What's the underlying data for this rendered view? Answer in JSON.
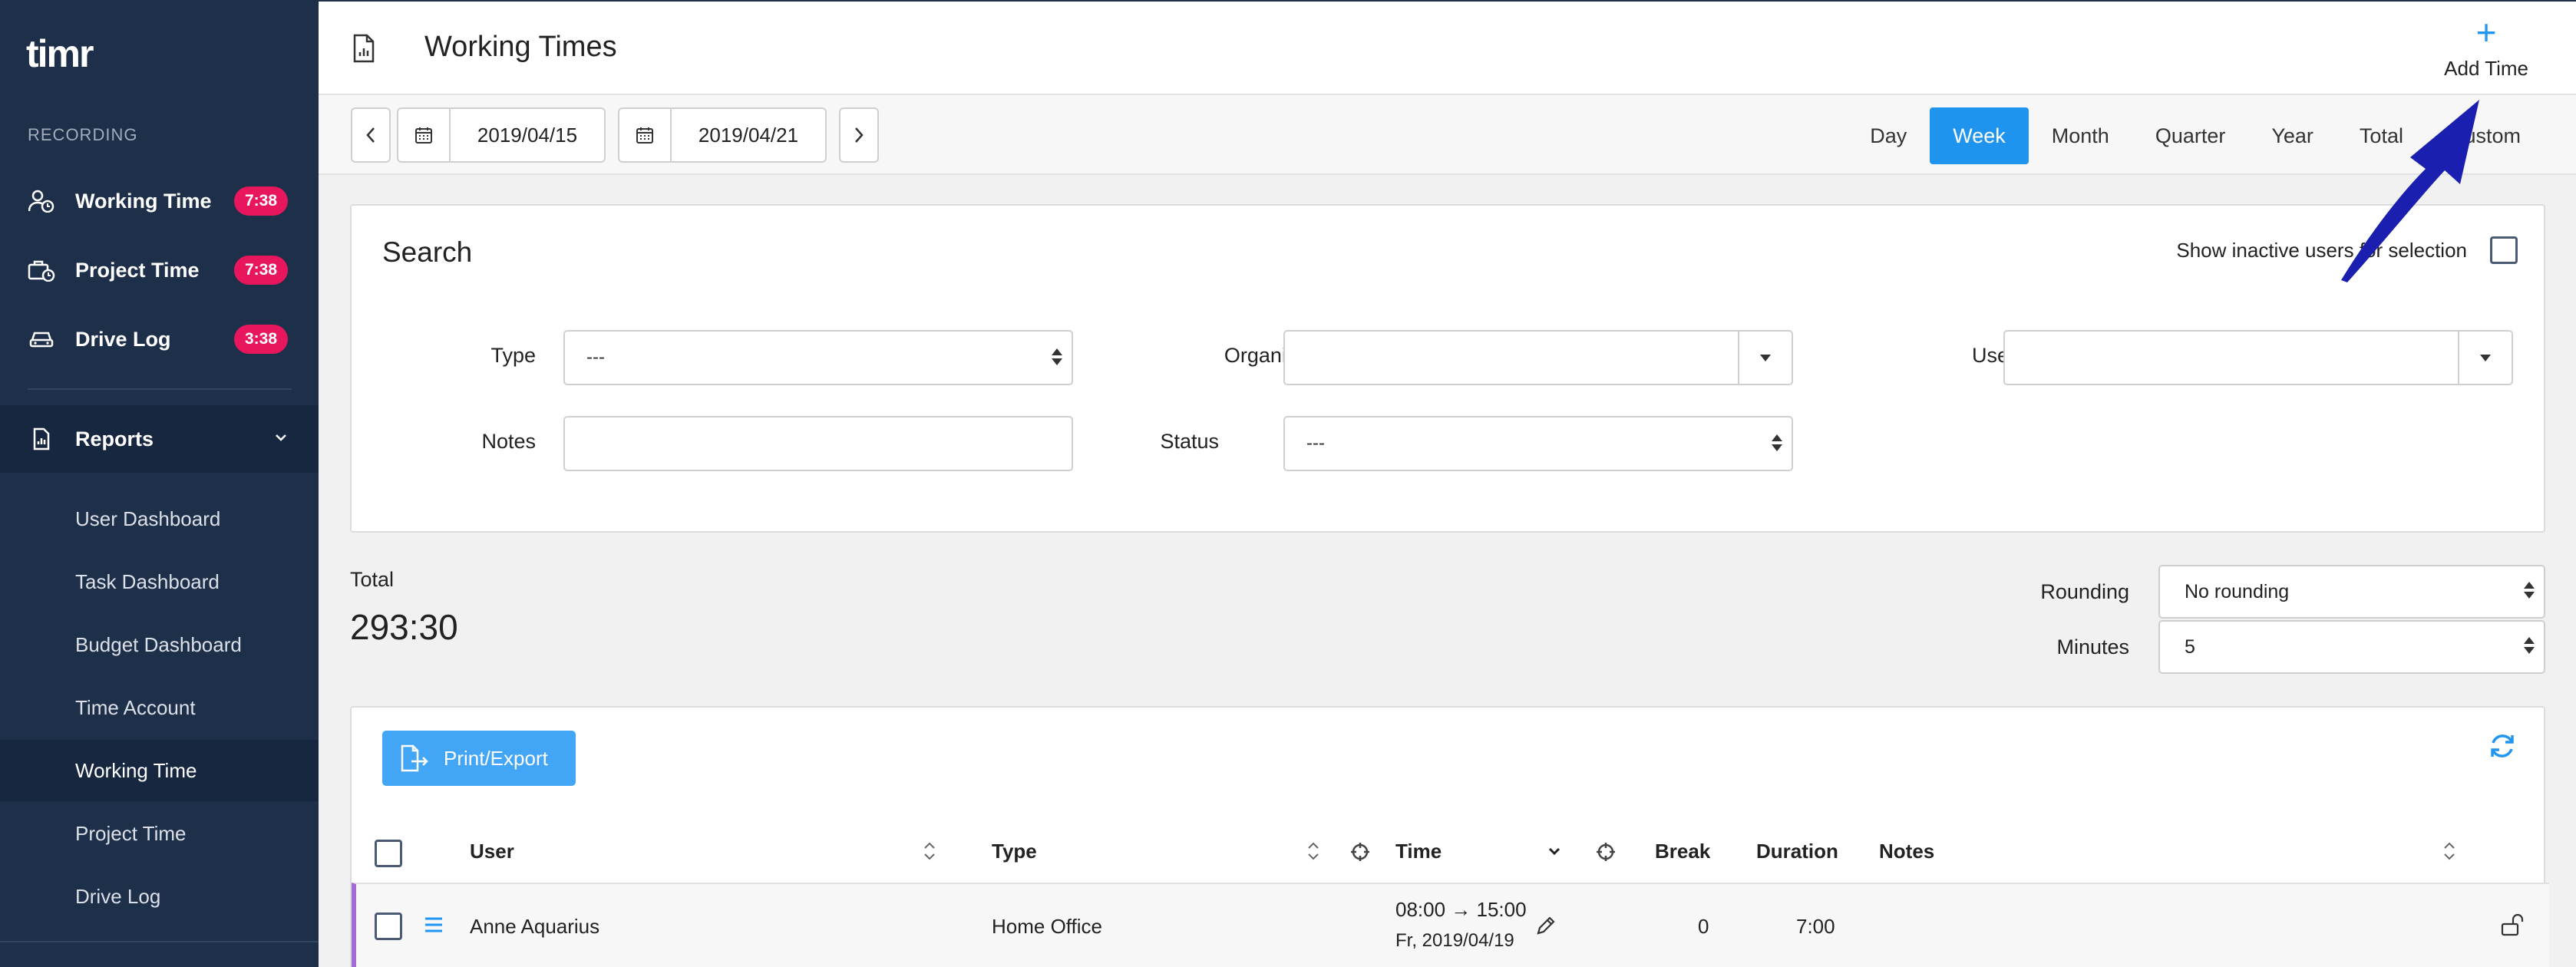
{
  "sidebar": {
    "logo": "timr",
    "section_label": "RECORDING",
    "items": [
      {
        "label": "Working Time",
        "badge": "7:38"
      },
      {
        "label": "Project Time",
        "badge": "7:38"
      },
      {
        "label": "Drive Log",
        "badge": "3:38"
      }
    ],
    "reports_label": "Reports",
    "sub_items": [
      "User Dashboard",
      "Task Dashboard",
      "Budget Dashboard",
      "Time Account",
      "Working Time",
      "Project Time",
      "Drive Log"
    ],
    "active_sub_item": "Working Time"
  },
  "header": {
    "title": "Working Times",
    "add_time_label": "Add Time"
  },
  "toolbar": {
    "date_from": "2019/04/15",
    "date_to": "2019/04/21",
    "range_tabs": [
      "Day",
      "Week",
      "Month",
      "Quarter",
      "Year",
      "Total",
      "Custom"
    ],
    "active_tab": "Week"
  },
  "search": {
    "title": "Search",
    "inactive_label": "Show inactive users for selection",
    "type_label": "Type",
    "type_value": "---",
    "organization_label": "Organization",
    "organization_value": "",
    "user_label": "User",
    "user_value": "",
    "notes_label": "Notes",
    "notes_value": "",
    "status_label": "Status",
    "status_value": "---"
  },
  "totals": {
    "label": "Total",
    "value": "293:30",
    "rounding_label": "Rounding",
    "rounding_value": "No rounding",
    "minutes_label": "Minutes",
    "minutes_value": "5"
  },
  "table": {
    "print_label": "Print/Export",
    "columns": {
      "user": "User",
      "type": "Type",
      "time": "Time",
      "break": "Break",
      "duration": "Duration",
      "notes": "Notes"
    },
    "rows": [
      {
        "user": "Anne Aquarius",
        "type": "Home Office",
        "time": "08:00 → 15:00",
        "date": "Fr, 2019/04/19",
        "break": "0",
        "duration": "7:00",
        "notes": ""
      }
    ]
  },
  "colors": {
    "sidebar_bg": "#1e2f4a",
    "accent": "#1f94ee",
    "badge": "#e8175d",
    "row_marker": "#a36ad6",
    "annotation_arrow": "#1a1fb0"
  }
}
